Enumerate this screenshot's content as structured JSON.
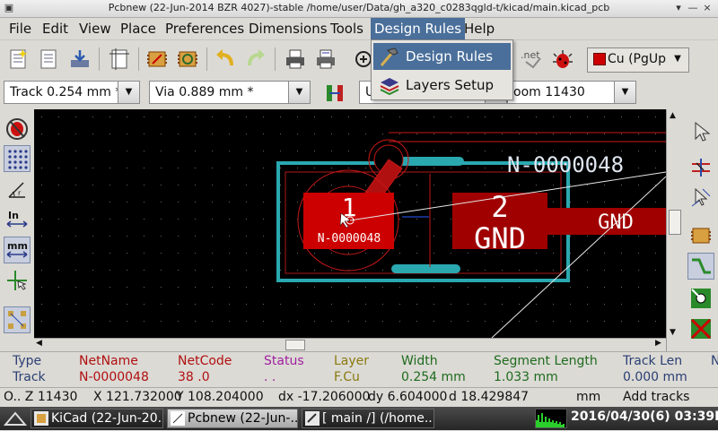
{
  "window": {
    "title": "Pcbnew (22-Jun-2014 BZR 4027)-stable /home/user/Data/gh_a320_c0283qgld-t/kicad/main.kicad_pcb",
    "controls": [
      "▾",
      "—",
      "×"
    ]
  },
  "menubar": {
    "items": [
      {
        "label": "File"
      },
      {
        "label": "Edit"
      },
      {
        "label": "View"
      },
      {
        "label": "Place"
      },
      {
        "label": "Preferences"
      },
      {
        "label": "Dimensions"
      },
      {
        "label": "Tools"
      },
      {
        "label": "Design Rules"
      },
      {
        "label": "Help"
      }
    ]
  },
  "dropdown": {
    "items": [
      {
        "label": "Design Rules"
      },
      {
        "label": "Layers Setup"
      }
    ]
  },
  "toolbar1": {
    "net_label": ".net",
    "layer_select": "Cu (PgUp)"
  },
  "toolbar2": {
    "track_select": "Track 0.254 mm *",
    "via_select": "Via 0.889 mm *",
    "grid_select": "U",
    "zoom_select": "oom 11430"
  },
  "board": {
    "pad1_number": "1",
    "pad1_net": "N-0000048",
    "pad2_number": "2",
    "pad2_net": "GND",
    "trace_net_label": "N-0000048",
    "right_net_label": "GND"
  },
  "message_panel": {
    "headers": [
      "Type",
      "NetName",
      "NetCode",
      "Status",
      "Layer",
      "Width",
      "Segment Length",
      "Track Len",
      "N"
    ],
    "values": [
      "Track",
      "N-0000048",
      "38 .0",
      ". .",
      "F.Cu",
      "0.254 mm",
      "1.033 mm",
      "0.000 mm",
      ""
    ],
    "colors": {
      "type": "#2a3f73",
      "netname": "#b01010",
      "netcode": "#b01010",
      "status": "#a020a0",
      "layer": "#8a7a10",
      "width": "#1e6b1e",
      "segment": "#1e6b1e",
      "tracklen": "#2a3f73"
    }
  },
  "status_bar": {
    "zoom": "O.. Z 11430",
    "x": "X 121.732000",
    "y": "Y 108.204000",
    "dx": "dx -17.206000",
    "dy": "dy 6.604000",
    "d": "d 18.429847",
    "units": "mm",
    "mode": "Add tracks"
  },
  "taskbar": {
    "tasks": [
      {
        "label": "KiCad (22-Jun-20..."
      },
      {
        "label": "Pcbnew (22-Jun-..."
      },
      {
        "label": "[ main /] (/home..."
      }
    ],
    "clock": "2016/04/30(6) 03:39PM"
  },
  "colors": {
    "pad": "#cc0000",
    "pad_dark": "#a00000",
    "silk": "#2aa8b0",
    "highlight": "#4a6f9a"
  }
}
